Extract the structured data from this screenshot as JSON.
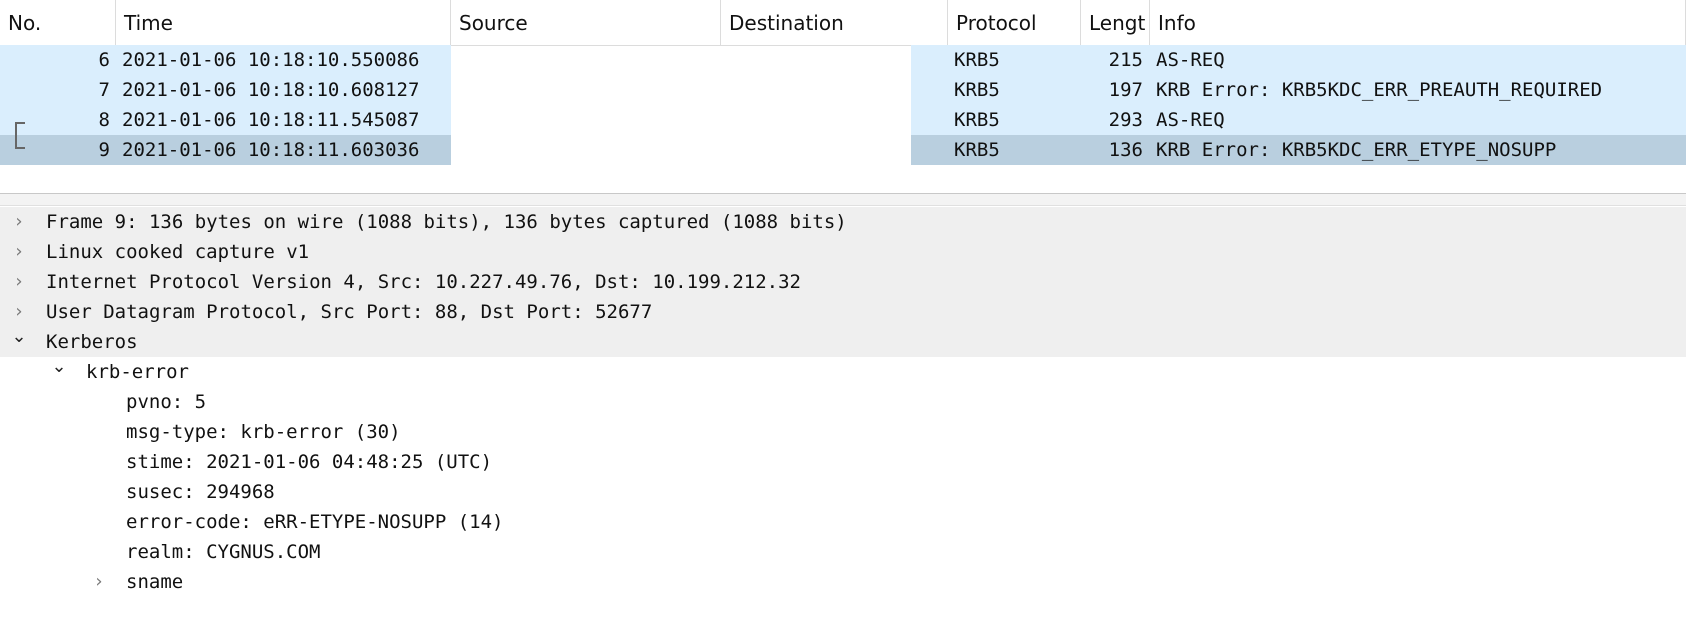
{
  "packet_list": {
    "columns": [
      "No.",
      "Time",
      "Source",
      "Destination",
      "Protocol",
      "Lengt",
      "Info"
    ],
    "rows": [
      {
        "no": "6",
        "time": "2021-01-06 10:18:10.550086",
        "protocol": "KRB5",
        "length": "215",
        "info": "AS-REQ"
      },
      {
        "no": "7",
        "time": "2021-01-06 10:18:10.608127",
        "protocol": "KRB5",
        "length": "197",
        "info": "KRB Error: KRB5KDC_ERR_PREAUTH_REQUIRED"
      },
      {
        "no": "8",
        "time": "2021-01-06 10:18:11.545087",
        "protocol": "KRB5",
        "length": "293",
        "info": "AS-REQ"
      },
      {
        "no": "9",
        "time": "2021-01-06 10:18:11.603036",
        "protocol": "KRB5",
        "length": "136",
        "info": "KRB Error: KRB5KDC_ERR_ETYPE_NOSUPP",
        "selected": true
      }
    ],
    "row_color": "#daeefd",
    "selected_row_color": "#b9cfdf"
  },
  "details": {
    "top_level": [
      {
        "label": "Frame 9: 136 bytes on wire (1088 bits), 136 bytes captured (1088 bits)",
        "expanded": false
      },
      {
        "label": "Linux cooked capture v1",
        "expanded": false
      },
      {
        "label": "Internet Protocol Version 4, Src: 10.227.49.76, Dst: 10.199.212.32",
        "expanded": false
      },
      {
        "label": "User Datagram Protocol, Src Port: 88, Dst Port: 52677",
        "expanded": false
      },
      {
        "label": "Kerberos",
        "expanded": true
      }
    ],
    "krb_error": {
      "label": "krb-error",
      "expanded": true,
      "fields": [
        "pvno: 5",
        "msg-type: krb-error (30)",
        "stime: 2021-01-06 04:48:25 (UTC)",
        "susec: 294968",
        "error-code: eRR-ETYPE-NOSUPP (14)",
        "realm: CYGNUS.COM"
      ],
      "sname": {
        "label": "sname",
        "expanded": false
      }
    },
    "arrow_collapsed": "›",
    "arrow_expanded": "⌄"
  }
}
